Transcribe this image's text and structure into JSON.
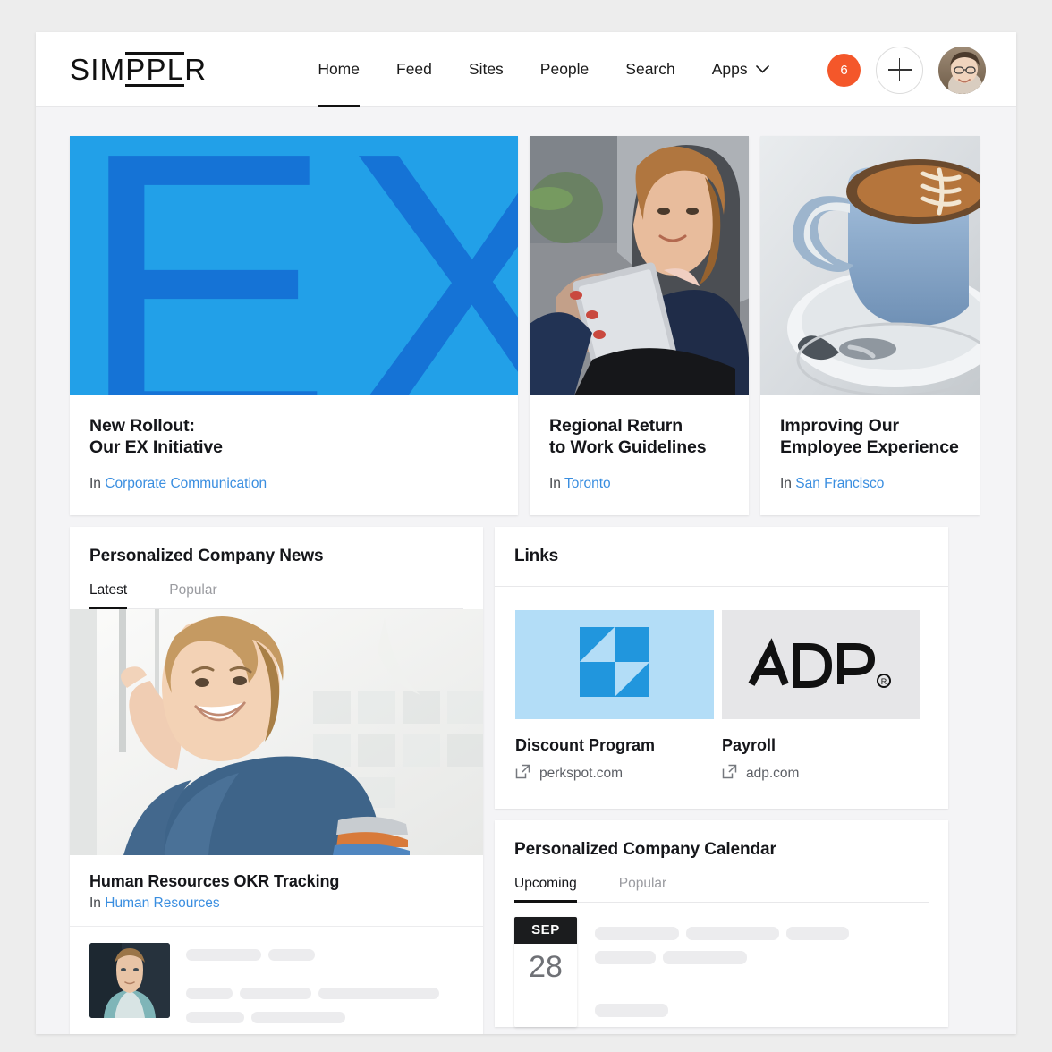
{
  "brand": {
    "logo_prefix": "SIM",
    "logo_barred": "PPL",
    "logo_suffix": "R",
    "accent_blue": "#3a8ee0",
    "badge_orange": "#f4572a",
    "hero_tile_bg": "#22a0e8",
    "hero_tile_letters_color": "#1573d6"
  },
  "header": {
    "nav": [
      {
        "label": "Home",
        "active": true
      },
      {
        "label": "Feed",
        "active": false
      },
      {
        "label": "Sites",
        "active": false
      },
      {
        "label": "People",
        "active": false
      },
      {
        "label": "Search",
        "active": false
      },
      {
        "label": "Apps",
        "active": false,
        "has_chevron": true
      }
    ],
    "notification_count": "6",
    "create_button_label": "+",
    "avatar_alt": "User profile photo"
  },
  "hero_cards": [
    {
      "image_kind": "ex-graphic",
      "graphic_text": "EX",
      "title_line1": "New Rollout:",
      "title_line2": "Our EX Initiative",
      "in_label": "In",
      "site": "Corporate Communication"
    },
    {
      "image_kind": "photo-woman-tablet",
      "title_line1": "Regional Return",
      "title_line2": "to Work Guidelines",
      "in_label": "In",
      "site": "Toronto"
    },
    {
      "image_kind": "photo-coffee-cup",
      "title_line1": "Improving Our",
      "title_line2": "Employee Experience",
      "in_label": "In",
      "site": "San Francisco"
    }
  ],
  "news_card": {
    "title": "Personalized Company News",
    "tabs": [
      {
        "label": "Latest",
        "active": true
      },
      {
        "label": "Popular",
        "active": false
      }
    ],
    "featured": {
      "image_kind": "photo-smiling-woman-office",
      "title": "Human Resources OKR Tracking",
      "in_label": "In",
      "site": "Human Resources"
    },
    "secondary": {
      "thumbnail_kind": "photo-man-portrait"
    }
  },
  "links_card": {
    "title": "Links",
    "items": [
      {
        "logo_kind": "perkspot-diamond",
        "name": "Discount Program",
        "url": "perkspot.com",
        "icon": "external-link-icon"
      },
      {
        "logo_kind": "adp-wordmark",
        "logo_text": "ADP",
        "name": "Payroll",
        "url": "adp.com",
        "icon": "external-link-icon"
      }
    ]
  },
  "calendar_card": {
    "title": "Personalized Company Calendar",
    "tabs": [
      {
        "label": "Upcoming",
        "active": true
      },
      {
        "label": "Popular",
        "active": false
      }
    ],
    "event": {
      "month": "SEP",
      "day": "28"
    }
  }
}
